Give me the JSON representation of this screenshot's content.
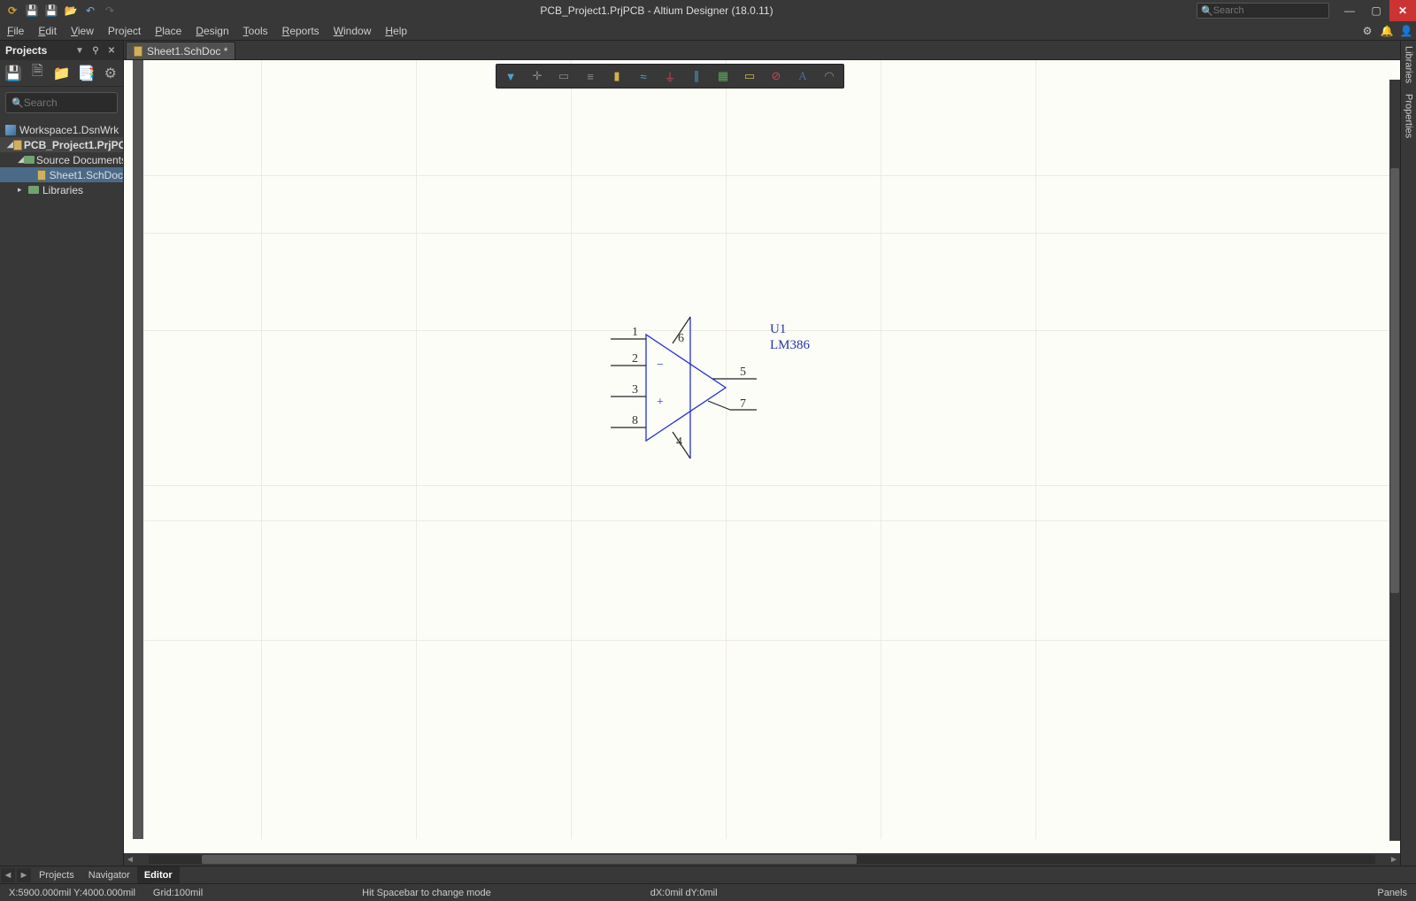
{
  "window": {
    "title": "PCB_Project1.PrjPCB - Altium Designer (18.0.11)",
    "search_placeholder": "Search"
  },
  "menu": [
    "File",
    "Edit",
    "View",
    "Project",
    "Place",
    "Design",
    "Tools",
    "Reports",
    "Window",
    "Help"
  ],
  "projects_panel": {
    "title": "Projects",
    "search_placeholder": "Search",
    "tree": {
      "workspace": "Workspace1.DsnWrk",
      "project": "PCB_Project1.PrjPCB",
      "source_folder": "Source Documents",
      "sheet": "Sheet1.SchDoc",
      "libraries": "Libraries"
    }
  },
  "tab": {
    "label": "Sheet1.SchDoc *"
  },
  "right_panels": [
    "Libraries",
    "Properties"
  ],
  "activebar_icons": [
    "filter-icon",
    "cross-select-icon",
    "rubber-band-icon",
    "align-icon",
    "part-icon",
    "net-icon",
    "power-port-icon",
    "bus-icon",
    "harness-icon",
    "directive-icon",
    "no-erc-icon",
    "text-icon",
    "arc-icon"
  ],
  "component": {
    "designator": "U1",
    "value": "LM386",
    "pins": {
      "p1": "1",
      "p2": "2",
      "p3": "3",
      "p4": "4",
      "p5": "5",
      "p6": "6",
      "p7": "7",
      "p8": "8"
    }
  },
  "bottom_tabs": {
    "items": [
      "Projects",
      "Navigator"
    ],
    "active": "Editor"
  },
  "status": {
    "coords": "X:5900.000mil Y:4000.000mil",
    "grid": "Grid:100mil",
    "hint": "Hit Spacebar to change mode",
    "delta": "dX:0mil dY:0mil",
    "panels": "Panels"
  }
}
